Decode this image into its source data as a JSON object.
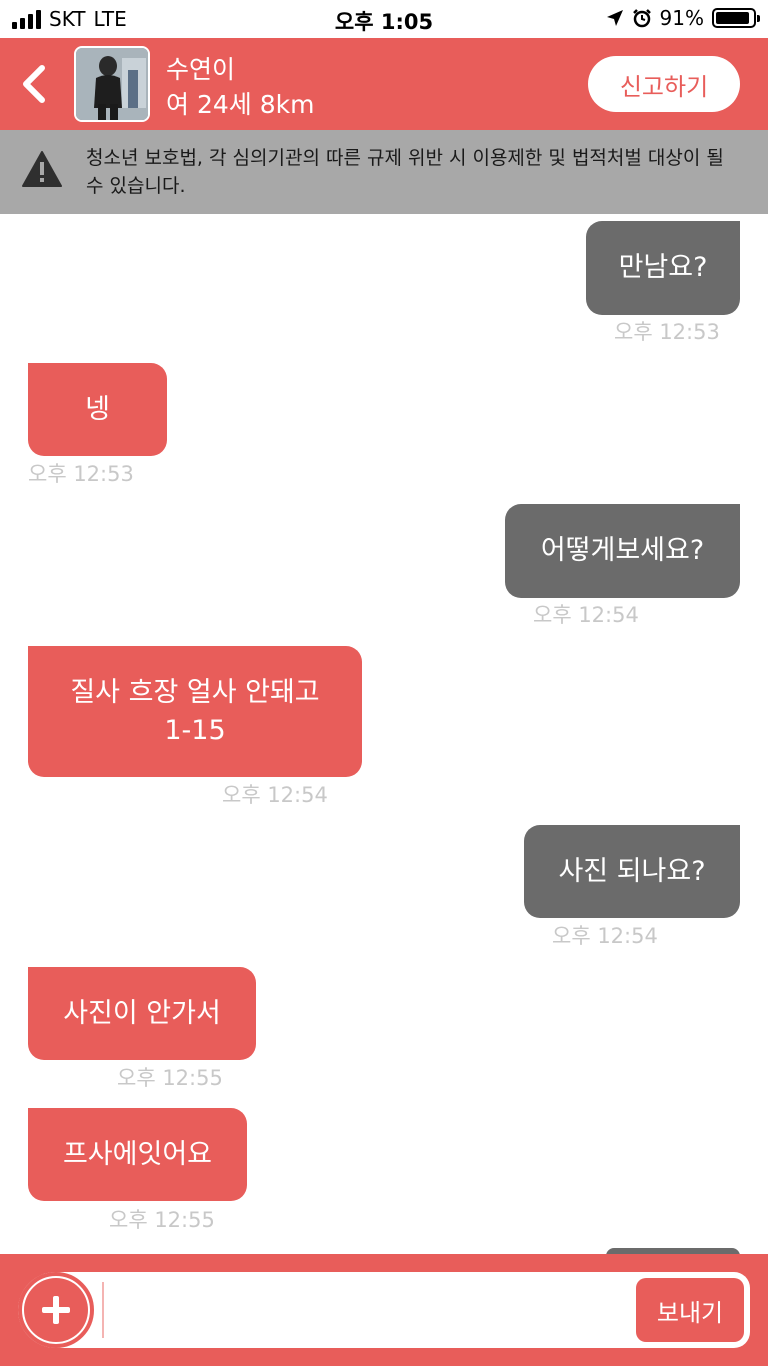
{
  "status_bar": {
    "carrier": "SKT",
    "network": "LTE",
    "time": "오후 1:05",
    "battery_percent_text": "91%",
    "battery_level": 0.91
  },
  "header": {
    "name": "수연이",
    "meta": "여 24세 8km",
    "report_label": "신고하기"
  },
  "warning": {
    "text": "청소년 보호법, 각 심의기관의 따른 규제 위반 시 이용제한 및 법적처벌 대상이 될 수 있습니다."
  },
  "messages": [
    {
      "side": "right",
      "text": "만남요?",
      "time": "오후 12:53"
    },
    {
      "side": "left",
      "text": "넹",
      "time": "오후 12:53"
    },
    {
      "side": "right",
      "text": "어떻게보세요?",
      "time": "오후 12:54"
    },
    {
      "side": "left",
      "line1": "질사 흐장 얼사 안돼고",
      "line2": "1-15",
      "time": "오후 12:54"
    },
    {
      "side": "right",
      "text": "사진 되나요?",
      "time": "오후 12:54"
    },
    {
      "side": "left",
      "text": "사진이 안가서",
      "time": "오후 12:55"
    },
    {
      "side": "left",
      "text": "프사에잇어요",
      "time": "오후 12:55"
    }
  ],
  "input": {
    "value": "",
    "send_label": "보내기"
  },
  "colors": {
    "accent": "#e85d5a",
    "outgoing_bubble": "#6b6b6b",
    "banner": "#a8a8a8"
  }
}
